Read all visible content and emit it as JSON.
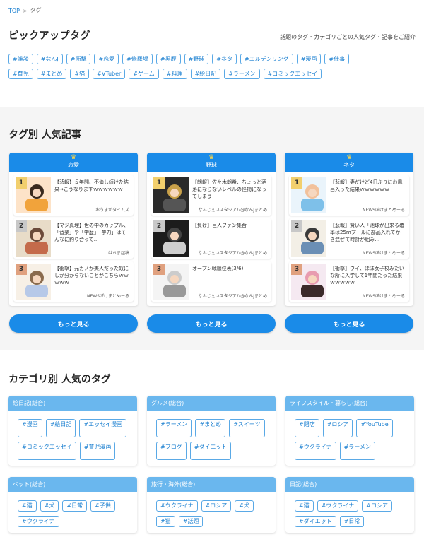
{
  "breadcrumb": {
    "top": "TOP",
    "sep": ">",
    "current": "タグ"
  },
  "pickup": {
    "title": "ピックアップタグ",
    "subtitle": "話題のタグ・カテゴリごとの人気タグ・記事をご紹介",
    "tags": [
      "#雑談",
      "#なんJ",
      "#衝撃",
      "#恋愛",
      "#修羅場",
      "#黒歴",
      "#野球",
      "#ネタ",
      "#エルデンリング",
      "#漫画",
      "#仕事",
      "#育児",
      "#まとめ",
      "#猫",
      "#VTuber",
      "#ゲーム",
      "#料理",
      "#絵日記",
      "#ラーメン",
      "#コミックエッセイ"
    ]
  },
  "popular": {
    "title": "タグ別 人気記事",
    "more_label": "もっと見る",
    "cards": [
      {
        "name": "恋愛",
        "items": [
          {
            "rank": "1",
            "title": "【悲報】５年間、不倫し続けた結果→こうなりますｗｗｗｗｗｗ",
            "source": "おうまがタイムズ"
          },
          {
            "rank": "2",
            "title": "【マジ真理】世の中のカップル、「音楽」や「学歴」「学力」はそんなに釣り合って…",
            "source": "はちま起稿"
          },
          {
            "rank": "3",
            "title": "【衝撃】元カノが美人だった奴にしか分からないことがこちらｗｗｗｗｗ",
            "source": "NEWSぽけまとめーる"
          }
        ]
      },
      {
        "name": "野球",
        "items": [
          {
            "rank": "1",
            "title": "【朗報】佐々木朗希、ちょっと酒落にならないレベルの怪物になってしまう",
            "source": "なんじぇいスタジアム@なんJまとめ"
          },
          {
            "rank": "2",
            "title": "【負け】巨人ファン集合",
            "source": "なんじぇいスタジアム@なんJまとめ"
          },
          {
            "rank": "3",
            "title": "オープン戦順位表(3/6)",
            "source": "なんじぇいスタジアム@なんJまとめ"
          }
        ]
      },
      {
        "name": "ネタ",
        "items": [
          {
            "rank": "1",
            "title": "【悲報】妻だけど4日ぶりにお風呂入った結果ｗｗｗｗｗｗ",
            "source": "NEWSぽけまとめーる"
          },
          {
            "rank": "2",
            "title": "【悲報】賢い人「池球が出来る確率は25mプールに部品入れてかき混ぜて時計が組み…",
            "source": "NEWSぽけまとめーる"
          },
          {
            "rank": "3",
            "title": "【衝撃】ウイ、ほぼ女子校みたいな所に入学して1年間たった結果ｗｗｗｗｗ",
            "source": "NEWSぽけまとめーる"
          }
        ]
      }
    ]
  },
  "categories": {
    "title": "カテゴリ別 人気のタグ",
    "groups": [
      {
        "name": "絵日記(総合)",
        "tags": [
          "#漫画",
          "#絵日記",
          "#エッセイ漫画",
          "#コミックエッセイ",
          "#育児漫画"
        ]
      },
      {
        "name": "グルメ(総合)",
        "tags": [
          "#ラーメン",
          "#まとめ",
          "#スイーツ",
          "#ブログ",
          "#ダイエット"
        ]
      },
      {
        "name": "ライフスタイル・暮らし(総合)",
        "tags": [
          "#閉店",
          "#ロシア",
          "#YouTube",
          "#ウクライナ",
          "#ラーメン"
        ]
      },
      {
        "name": "ペット(総合)",
        "tags": [
          "#猫",
          "#犬",
          "#日常",
          "#子供",
          "#ウクライナ"
        ]
      },
      {
        "name": "旅行・海外(総合)",
        "tags": [
          "#ウクライナ",
          "#ロシア",
          "#犬",
          "#猫",
          "#話題"
        ]
      },
      {
        "name": "日記(総合)",
        "tags": [
          "#猫",
          "#ウクライナ",
          "#ロシア",
          "#ダイエット",
          "#日常"
        ]
      }
    ]
  },
  "colors": {
    "accent": "#1a8be8",
    "tag_text": "#1a7fd0",
    "cat_head": "#6ab7ee",
    "rank1": "#f2cf6d",
    "rank2": "#c8c8c8",
    "rank3": "#e0a17f"
  }
}
